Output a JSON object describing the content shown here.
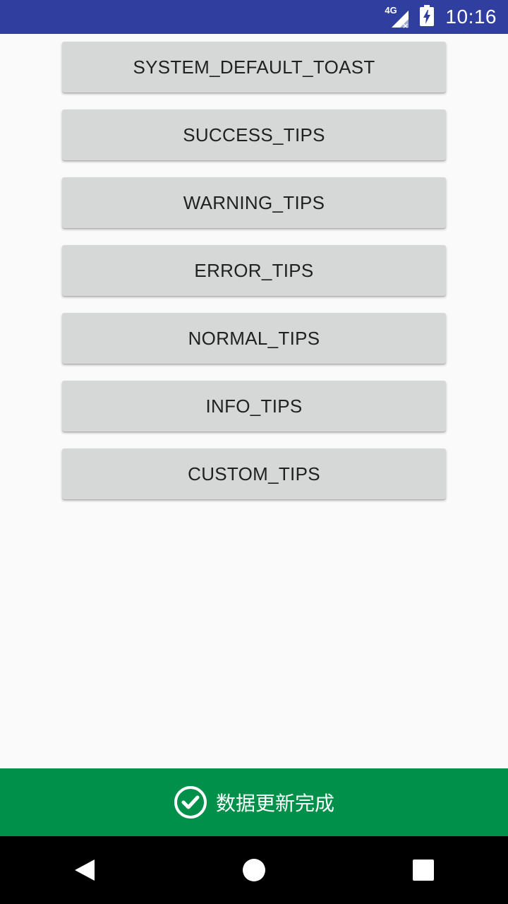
{
  "status_bar": {
    "network_label": "4G",
    "time": "10:16",
    "color": "#303f9f"
  },
  "buttons": [
    {
      "label": "SYSTEM_DEFAULT_TOAST"
    },
    {
      "label": "SUCCESS_TIPS"
    },
    {
      "label": "WARNING_TIPS"
    },
    {
      "label": "ERROR_TIPS"
    },
    {
      "label": "NORMAL_TIPS"
    },
    {
      "label": "INFO_TIPS"
    },
    {
      "label": "CUSTOM_TIPS"
    }
  ],
  "toast": {
    "icon": "check-circle-icon",
    "message": "数据更新完成",
    "color": "#009049"
  },
  "nav_bar": {
    "back": "back-icon",
    "home": "home-icon",
    "recents": "recents-icon"
  }
}
